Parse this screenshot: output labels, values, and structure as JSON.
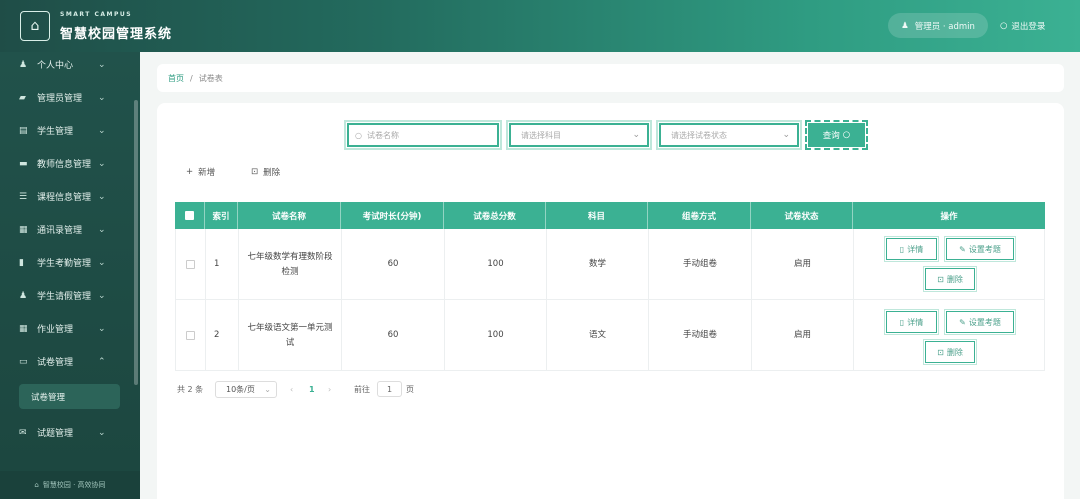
{
  "header": {
    "brand_sub": "SMART CAMPUS",
    "brand_title": "智慧校园管理系统",
    "user_label": "管理员 · admin",
    "logout_label": "退出登录"
  },
  "sidebar": {
    "items": [
      {
        "label": "个人中心",
        "icon": "user-icon",
        "glyph": "♟"
      },
      {
        "label": "管理员管理",
        "icon": "briefcase-icon",
        "glyph": "▰"
      },
      {
        "label": "学生管理",
        "icon": "student-icon",
        "glyph": "▤"
      },
      {
        "label": "教师信息管理",
        "icon": "monitor-icon",
        "glyph": "▬"
      },
      {
        "label": "课程信息管理",
        "icon": "course-icon",
        "glyph": "☰"
      },
      {
        "label": "通讯录管理",
        "icon": "contacts-icon",
        "glyph": "▦"
      },
      {
        "label": "学生考勤管理",
        "icon": "chart-icon",
        "glyph": "▮"
      },
      {
        "label": "学生请假管理",
        "icon": "leave-icon",
        "glyph": "♟"
      },
      {
        "label": "作业管理",
        "icon": "grid-icon",
        "glyph": "▦"
      },
      {
        "label": "试卷管理",
        "icon": "paper-icon",
        "glyph": "▭"
      },
      {
        "label": "试题管理",
        "icon": "mail-icon",
        "glyph": "✉"
      }
    ],
    "sub_item": "试卷管理",
    "footer": "智慧校园 · 高效协同"
  },
  "breadcrumb": {
    "home": "首页",
    "separator": "/",
    "current": "试卷表"
  },
  "filters": {
    "search_placeholder": "试卷名称",
    "subject_placeholder": "请选择科目",
    "status_placeholder": "请选择试卷状态",
    "query_label": "查询"
  },
  "toolbar": {
    "add_label": "新增",
    "delete_label": "删除"
  },
  "table": {
    "columns": [
      "索引",
      "试卷名称",
      "考试时长(分钟)",
      "试卷总分数",
      "科目",
      "组卷方式",
      "试卷状态",
      "操作"
    ],
    "rows": [
      {
        "index": "1",
        "name_line1": "七年级数学有理数阶段",
        "name_line2": "检测",
        "duration": "60",
        "score": "100",
        "subject": "数学",
        "method": "手动组卷",
        "status": "启用"
      },
      {
        "index": "2",
        "name_line1": "七年级语文第一单元测",
        "name_line2": "试",
        "duration": "60",
        "score": "100",
        "subject": "语文",
        "method": "手动组卷",
        "status": "启用"
      }
    ],
    "actions": {
      "detail": "详情",
      "set_exam": "设置考题",
      "delete": "删除"
    }
  },
  "pagination": {
    "total": "共 2 条",
    "page_size": "10条/页",
    "prev": "‹",
    "current_page": "1",
    "next": "›",
    "goto_prefix": "前往",
    "goto_value": "1",
    "goto_suffix": "页"
  },
  "colors": {
    "accent": "#3bb193",
    "sidebar_bg": "#21524b"
  }
}
